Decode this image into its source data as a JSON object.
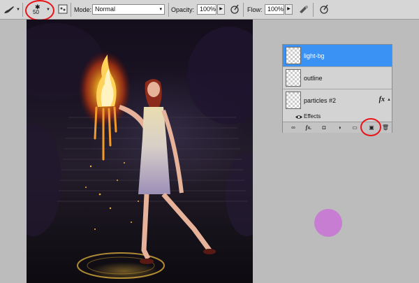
{
  "options_bar": {
    "brush_size": "50",
    "mode_label": "Mode:",
    "mode_value": "Normal",
    "opacity_label": "Opacity:",
    "opacity_value": "100%",
    "flow_label": "Flow:",
    "flow_value": "100%"
  },
  "layers": {
    "items": [
      {
        "name": "light-bg",
        "selected": true
      },
      {
        "name": "outline",
        "selected": false
      },
      {
        "name": "particles #2",
        "selected": false,
        "fx": "fx"
      }
    ],
    "effects_label": "Effects"
  },
  "colors": {
    "highlight_ring": "#e8141a",
    "selected_layer": "#3a93f4",
    "swatch": "#c77dd2"
  }
}
